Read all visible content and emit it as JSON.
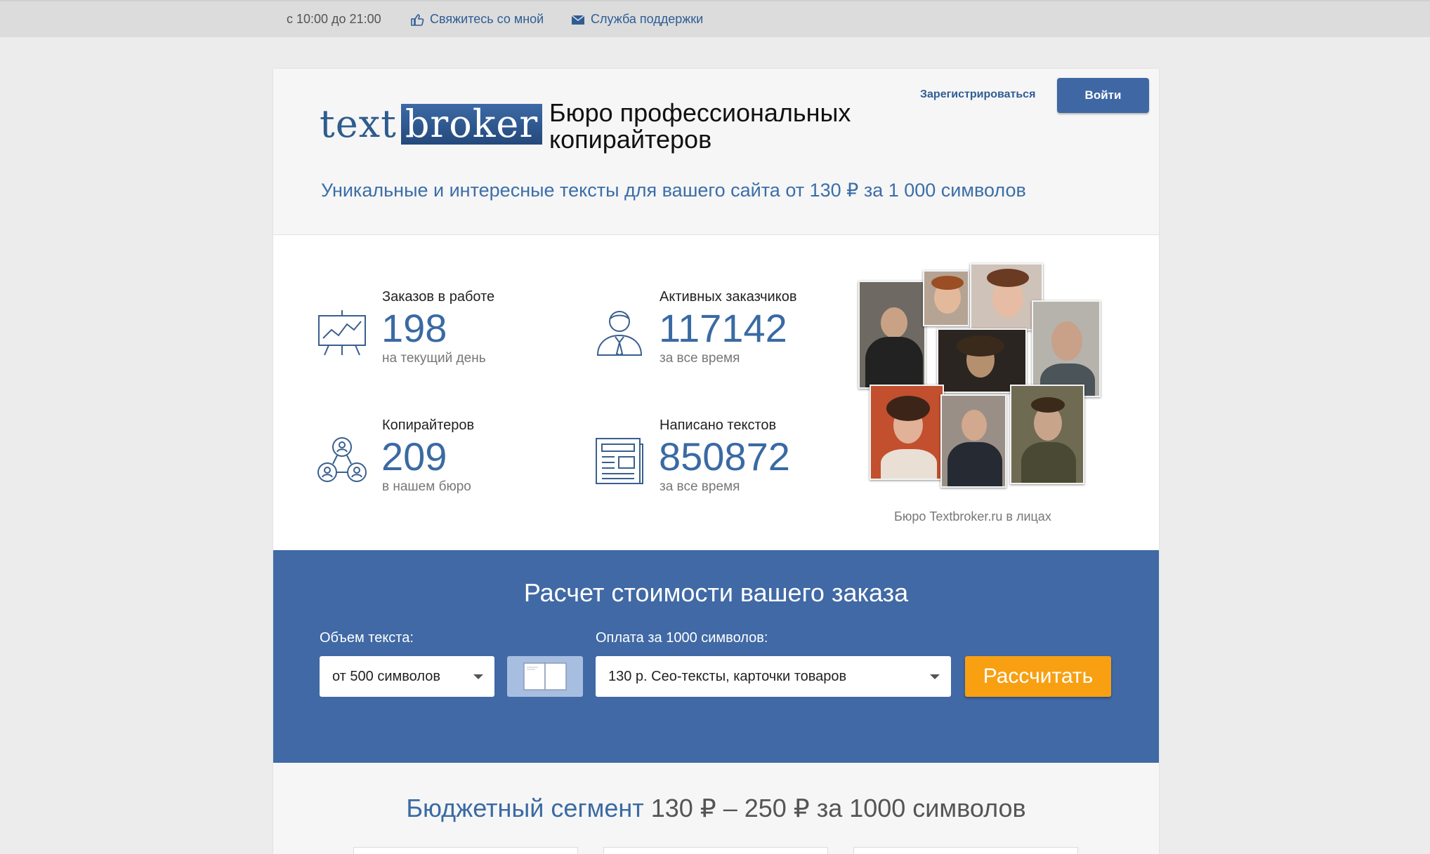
{
  "topbar": {
    "hours": "с 10:00 до 21:00",
    "contact": "Свяжитесь со мной",
    "support": "Служба поддержки"
  },
  "header": {
    "logo_left": "text",
    "logo_right": "broker",
    "tagline": "Бюро профессиональных копирайтеров",
    "register": "Зарегистрироваться",
    "login": "Войти",
    "subtitle": "Уникальные и интересные тексты для вашего сайта от 130 ₽ за 1 000 символов"
  },
  "stats": [
    {
      "label": "Заказов в работе",
      "value": "198",
      "note": "на текущий день",
      "icon": "presentation-chart-icon"
    },
    {
      "label": "Активных заказчиков",
      "value": "117142",
      "note": "за все время",
      "icon": "person-icon"
    },
    {
      "label": "Копирайтеров",
      "value": "209",
      "note": "в нашем бюро",
      "icon": "team-icon"
    },
    {
      "label": "Написано текстов",
      "value": "850872",
      "note": "за все время",
      "icon": "newspaper-icon"
    }
  ],
  "collage": {
    "caption": "Бюро Textbroker.ru в лицах"
  },
  "calculator": {
    "title": "Расчет стоимости вашего заказа",
    "volume_label": "Объем текста:",
    "volume_value": "от 500 символов",
    "price_label": "Оплата за 1000 символов:",
    "price_value": "130 р. Сео-тексты, карточки товаров",
    "button": "Рассчитать"
  },
  "budget": {
    "title_accent": "Бюджетный сегмент",
    "title_rest": " 130 ₽ – 250 ₽ за 1000 символов"
  },
  "colors": {
    "brand_blue": "#4069a5",
    "accent_orange": "#f8a011",
    "link_blue": "#2f5d94"
  }
}
